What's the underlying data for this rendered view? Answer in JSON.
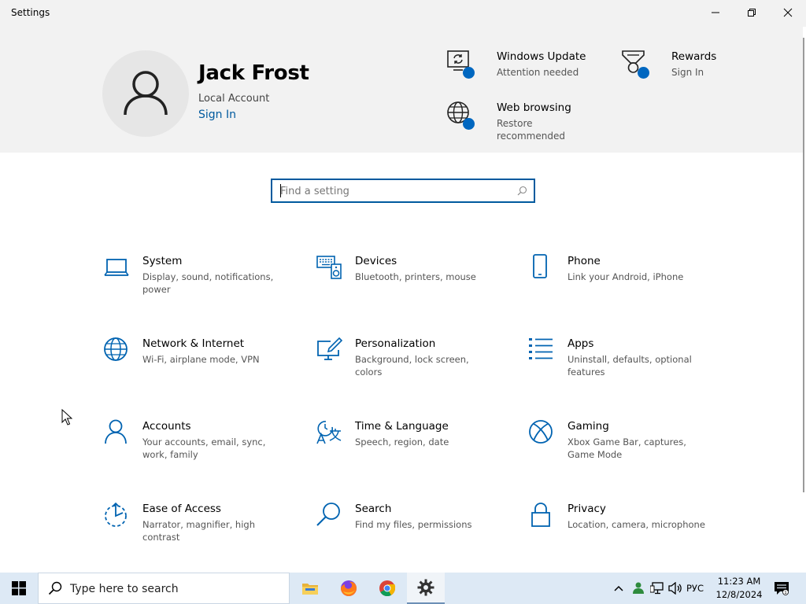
{
  "window": {
    "title": "Settings",
    "controls": [
      "minimize",
      "maximize",
      "close"
    ]
  },
  "header": {
    "user": {
      "name": "Jack Frost",
      "account_type": "Local Account",
      "sign_in_link": "Sign In"
    },
    "items": [
      {
        "id": "windows-update",
        "title": "Windows Update",
        "subtitle": "Attention needed",
        "icon": "sync-monitor-icon"
      },
      {
        "id": "rewards",
        "title": "Rewards",
        "subtitle": "Sign In",
        "icon": "trophy-icon"
      },
      {
        "id": "web-browsing",
        "title": "Web browsing",
        "subtitle_line1": "Restore",
        "subtitle_line2": "recommended",
        "icon": "globe-icon"
      }
    ],
    "status_dot_color": "#0067c0"
  },
  "search": {
    "placeholder": "Find a setting",
    "value": ""
  },
  "categories": [
    {
      "name": "System",
      "description": "Display, sound, notifications, power",
      "icon": "laptop-icon"
    },
    {
      "name": "Devices",
      "description": "Bluetooth, printers, mouse",
      "icon": "keyboard-speaker-icon"
    },
    {
      "name": "Phone",
      "description": "Link your Android, iPhone",
      "icon": "phone-icon"
    },
    {
      "name": "Network & Internet",
      "description": "Wi-Fi, airplane mode, VPN",
      "icon": "globe-icon"
    },
    {
      "name": "Personalization",
      "description": "Background, lock screen, colors",
      "icon": "monitor-pen-icon"
    },
    {
      "name": "Apps",
      "description": "Uninstall, defaults, optional features",
      "icon": "list-icon"
    },
    {
      "name": "Accounts",
      "description": "Your accounts, email, sync, work, family",
      "icon": "person-icon"
    },
    {
      "name": "Time & Language",
      "description": "Speech, region, date",
      "icon": "time-language-icon"
    },
    {
      "name": "Gaming",
      "description": "Xbox Game Bar, captures, Game Mode",
      "icon": "xbox-icon"
    },
    {
      "name": "Ease of Access",
      "description": "Narrator, magnifier, high contrast",
      "icon": "ease-of-access-icon"
    },
    {
      "name": "Search",
      "description": "Find my files, permissions",
      "icon": "magnifier-icon"
    },
    {
      "name": "Privacy",
      "description": "Location, camera, microphone",
      "icon": "lock-icon"
    }
  ],
  "taskbar": {
    "search_text": "Type here to search",
    "apps": [
      "file-explorer-icon",
      "firefox-icon",
      "chrome-icon",
      "settings-gear-icon"
    ],
    "tray": {
      "language": "РУС",
      "time": "11:23 AM",
      "date": "12/8/2024"
    }
  },
  "colors": {
    "accent": "#005a9e",
    "icon": "#0063b1",
    "header_bg": "#f2f2f2",
    "taskbar_bg": "#dde9f5"
  }
}
